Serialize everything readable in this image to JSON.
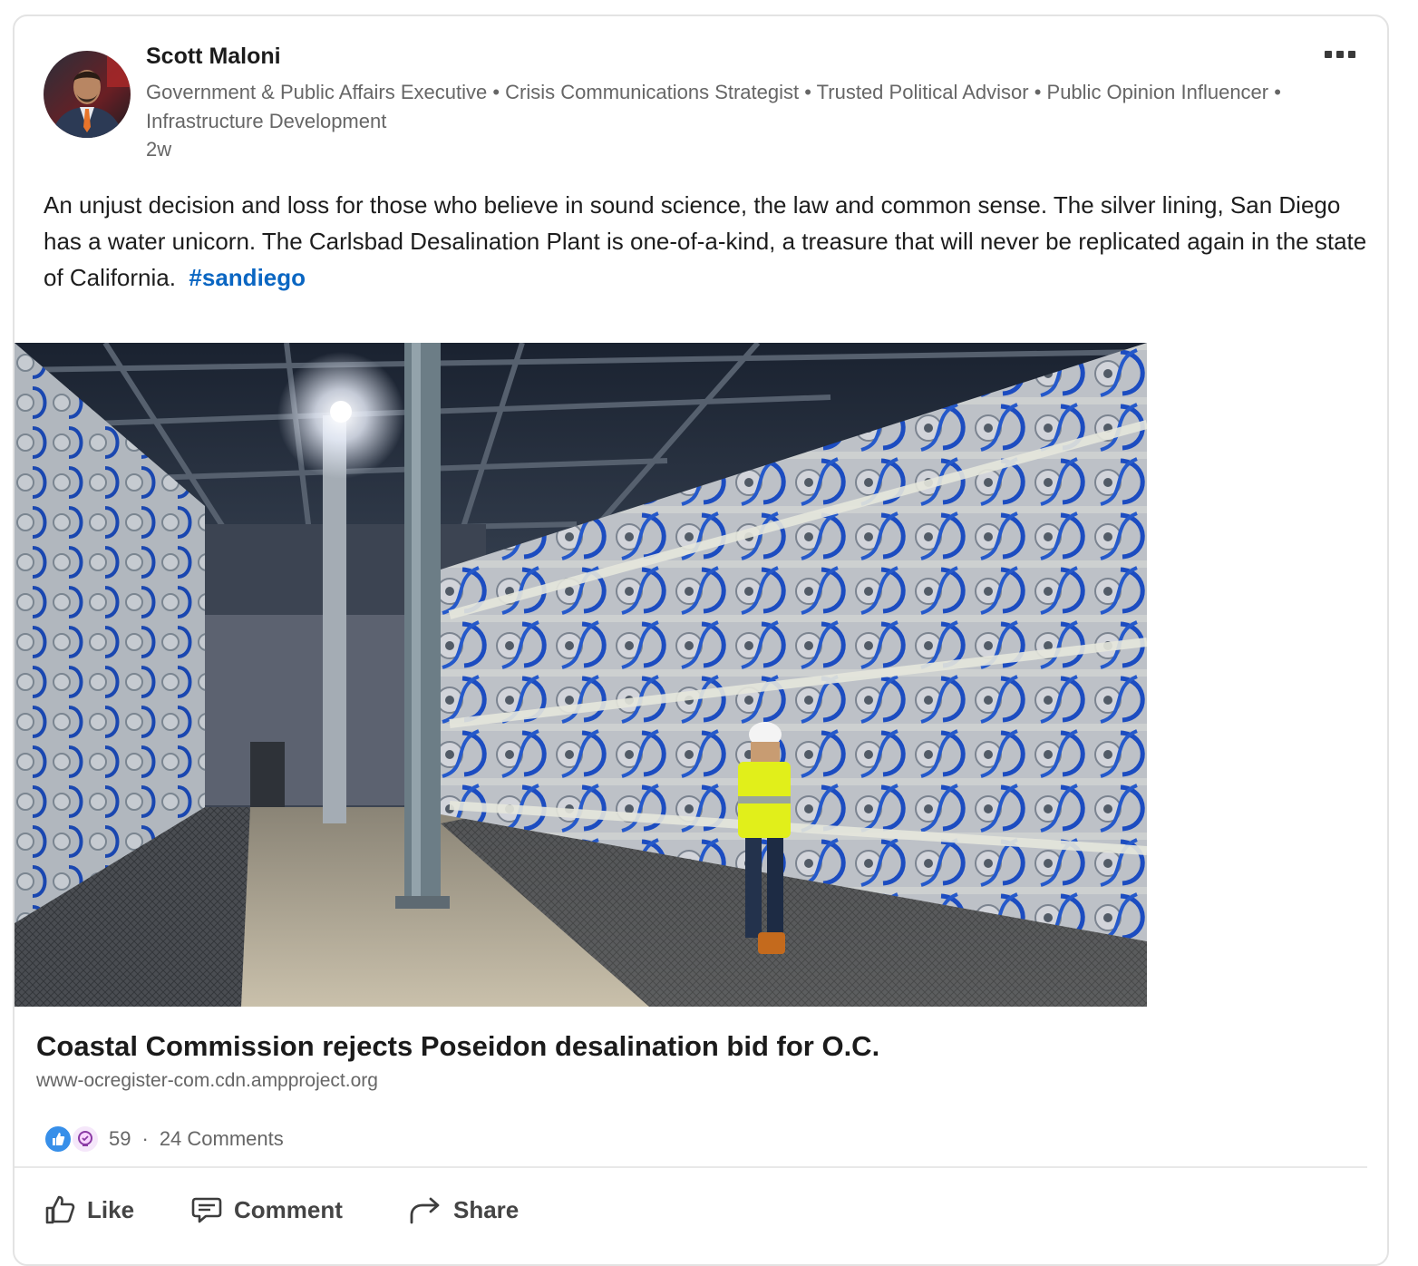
{
  "author": {
    "name": "Scott Maloni",
    "headline": "Government & Public Affairs Executive • Crisis Communications Strategist • Trusted Political Advisor • Public Opinion Influencer • Infrastructure Development",
    "timestamp": "2w"
  },
  "post": {
    "text": "An unjust decision and loss for those who believe in sound science, the law and common sense. The silver lining, San Diego has a water unicorn. The Carlsbad Desalination Plant is one-of-a-kind, a treasure that will never be replicated again in the state of California.",
    "hashtag": "#sandiego"
  },
  "link_preview": {
    "title": "Coastal Commission rejects Poseidon desalination bid for O.C.",
    "source": "www-ocregister-com.cdn.ampproject.org"
  },
  "social": {
    "reaction_count": "59",
    "separator": "·",
    "comments": "24 Comments"
  },
  "actions": {
    "like": "Like",
    "comment": "Comment",
    "share": "Share"
  },
  "colors": {
    "accent": "#0a66c2",
    "like_reaction": "#378fe9",
    "muted_text": "#666666"
  },
  "icons": [
    "more-options-icon",
    "like-reaction-icon",
    "insightful-reaction-icon",
    "like-icon",
    "comment-icon",
    "share-icon"
  ]
}
